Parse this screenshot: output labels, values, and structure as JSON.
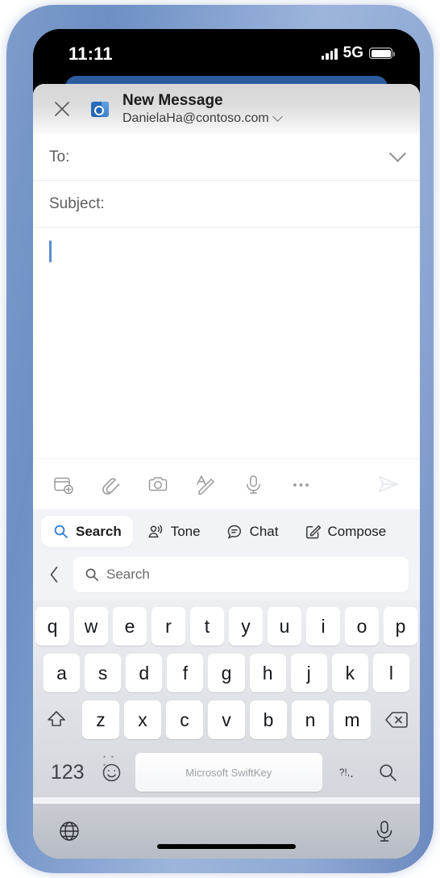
{
  "status_bar": {
    "time": "11:11",
    "network": "5G",
    "signal_icon": "signal-bars-icon",
    "battery_icon": "battery-icon"
  },
  "compose": {
    "close_icon": "close-icon",
    "app_icon": "outlook-icon",
    "title": "New Message",
    "account": "DanielaHa@contoso.com",
    "account_chevron_icon": "chevron-down-icon",
    "to_label": "To:",
    "to_expand_icon": "chevron-down-icon",
    "subject_label": "Subject:",
    "body_value": "",
    "toolbar": [
      {
        "name": "calendar-add-icon",
        "label": "Add calendar event"
      },
      {
        "name": "paperclip-icon",
        "label": "Attach file"
      },
      {
        "name": "camera-icon",
        "label": "Camera"
      },
      {
        "name": "text-format-icon",
        "label": "Formatting"
      },
      {
        "name": "microphone-icon",
        "label": "Dictate"
      },
      {
        "name": "more-icon",
        "label": "More options"
      }
    ],
    "send_icon": "send-icon"
  },
  "keyboard": {
    "feature_row": [
      {
        "label": "Search",
        "icon": "search-icon",
        "active": true
      },
      {
        "label": "Tone",
        "icon": "tone-icon",
        "active": false
      },
      {
        "label": "Chat",
        "icon": "chat-icon",
        "active": false
      },
      {
        "label": "Compose",
        "icon": "compose-icon",
        "active": false
      }
    ],
    "search": {
      "back_icon": "chevron-left-icon",
      "field_icon": "search-icon",
      "placeholder": "Search",
      "value": ""
    },
    "rows": [
      [
        "q",
        "w",
        "e",
        "r",
        "t",
        "y",
        "u",
        "i",
        "o",
        "p"
      ],
      [
        "a",
        "s",
        "d",
        "f",
        "g",
        "h",
        "j",
        "k",
        "l"
      ],
      [
        "z",
        "x",
        "c",
        "v",
        "b",
        "n",
        "m"
      ]
    ],
    "shift_icon": "shift-icon",
    "backspace_icon": "backspace-icon",
    "numbers_key": "123",
    "emoji_icon": "emoji-icon",
    "space_label": "Microsoft SwiftKey",
    "punctuation_key": "?!,",
    "search_key_icon": "search-icon",
    "globe_icon": "globe-icon",
    "mic_icon": "microphone-icon"
  },
  "colors": {
    "outlook_blue": "#2d5c9e",
    "accent_blue": "#2f7bd6",
    "caret_blue": "#5b8dd0",
    "frame_blue": "#7e9ccb"
  }
}
